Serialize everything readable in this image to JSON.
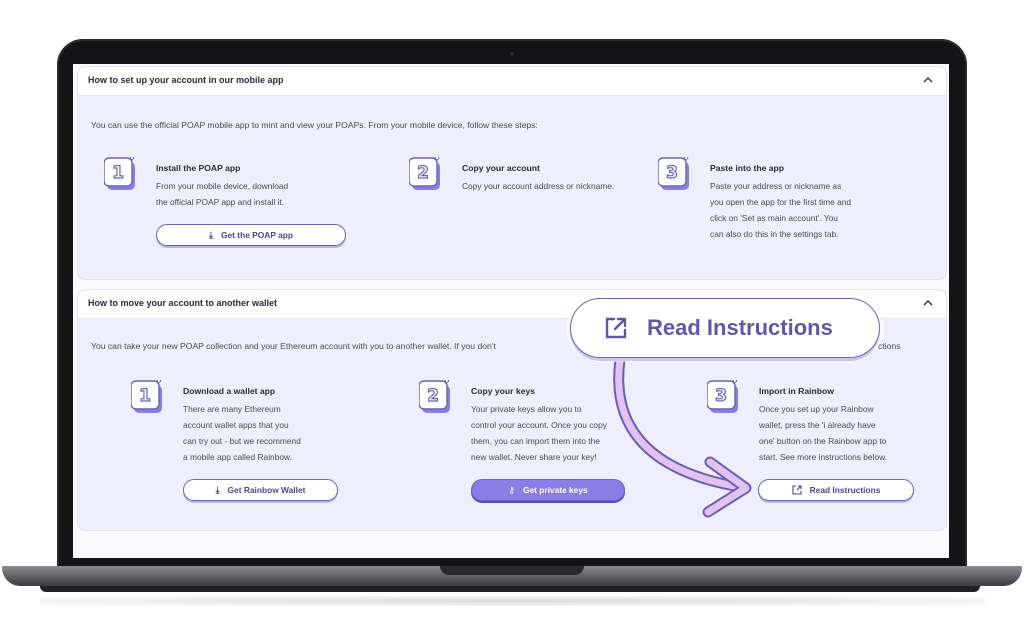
{
  "section1": {
    "title": "How to set up your account in our mobile app",
    "intro": "You can use the official POAP mobile app to mint and view your POAPs. From your mobile device, follow these steps:",
    "steps": [
      {
        "number": "1",
        "title": "Install the POAP app",
        "lines": [
          "From your mobile device, download",
          "the official POAP app and install it."
        ],
        "button": "Get the POAP app",
        "button_icon": "download-icon"
      },
      {
        "number": "2",
        "title": "Copy your account",
        "lines": [
          "Copy your account address or nickname."
        ]
      },
      {
        "number": "3",
        "title": "Paste into the app",
        "lines": [
          "Paste your address or nickname as",
          "you open the app for the first time and",
          "click on 'Set as main account'. You",
          "can also do this in the settings tab."
        ]
      }
    ]
  },
  "section2": {
    "title": "How to move your account to another wallet",
    "intro_left": "You can take your new POAP collection and your Ethereum account with you to another wallet. If you don't",
    "intro_right": "ctions",
    "steps": [
      {
        "number": "1",
        "title": "Download a wallet app",
        "lines": [
          "There are many Ethereum",
          "account wallet apps that you",
          "can try out - but we recommend",
          "a mobile app called Rainbow."
        ],
        "button": "Get Rainbow Wallet",
        "button_icon": "download-icon"
      },
      {
        "number": "2",
        "title": "Copy your keys",
        "lines": [
          "Your private keys allow you to",
          "control your account. Once you copy",
          "them, you can import them into the",
          "new wallet. Never share your key!"
        ],
        "button": "Get private keys",
        "button_icon": "key-icon"
      },
      {
        "number": "3",
        "title": "Import in Rainbow",
        "lines": [
          "Once you set up your Rainbow",
          "wallet, press the 'i already have",
          "one' button on the Rainbow app to",
          "start. See more instructions below."
        ],
        "button": "Read Instructions",
        "button_icon": "external-link-icon"
      }
    ]
  },
  "callout": {
    "label": "Read Instructions",
    "icon": "external-link-icon"
  },
  "colors": {
    "accent": "#6a64b8",
    "primary_button": "#8a7ee6",
    "panel_bg": "#efeefc",
    "arrow": "#d6b3ec"
  }
}
